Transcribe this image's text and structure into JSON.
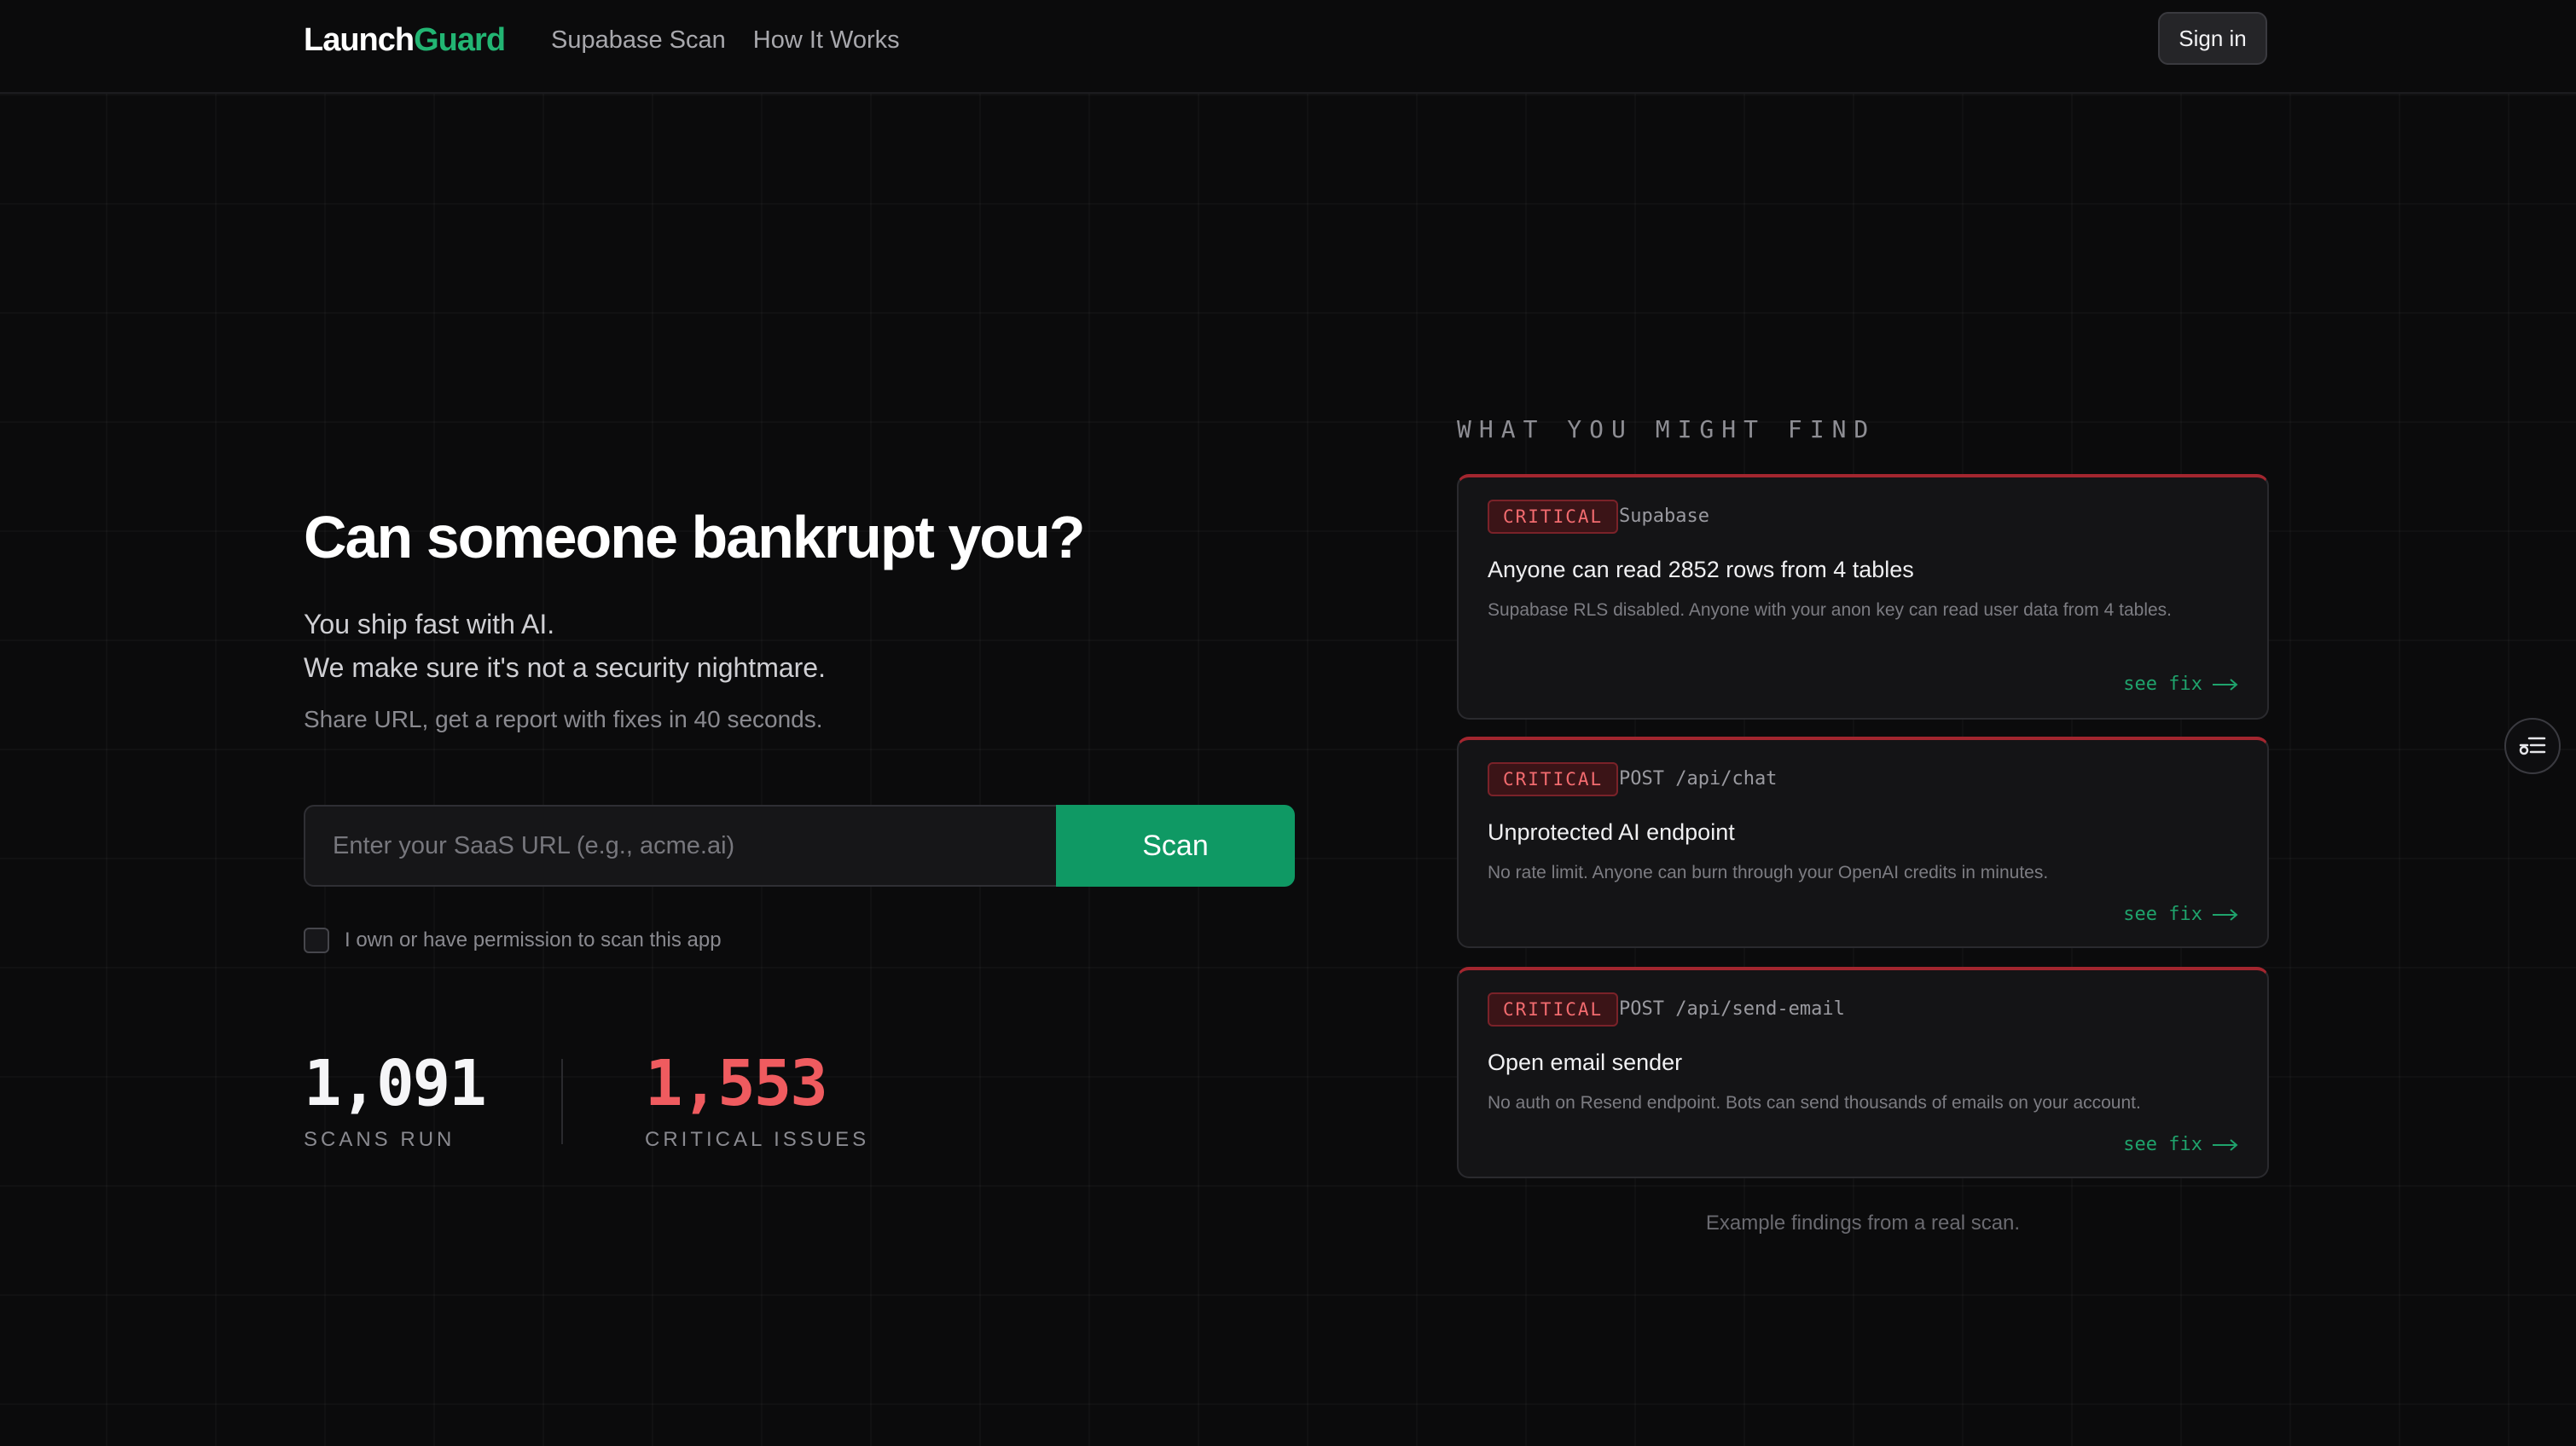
{
  "nav": {
    "logo_part1": "Launch",
    "logo_part2": "Guard",
    "links": [
      "Supabase Scan",
      "How It Works"
    ],
    "signin_label": "Sign in"
  },
  "hero": {
    "title": "Can someone bankrupt you?",
    "subtitle_line1": "You ship fast with AI.",
    "subtitle_line2": "We make sure it's not a security nightmare.",
    "tagline": "Share URL, get a report with fixes in 40 seconds.",
    "input_placeholder": "Enter your SaaS URL (e.g., acme.ai)",
    "input_value": "",
    "scan_label": "Scan",
    "permission_label": "I own or have permission to scan this app",
    "permission_checked": false
  },
  "stats": [
    {
      "value": "1,091",
      "label": "SCANS RUN",
      "color": "#f5f5f7"
    },
    {
      "value": "1,553",
      "label": "CRITICAL ISSUES",
      "color": "#ef5b5f"
    }
  ],
  "findings": {
    "title": "WHAT YOU MIGHT FIND",
    "cards": [
      {
        "severity": "CRITICAL",
        "tag": "Supabase",
        "title": "Anyone can read 2852 rows from 4 tables",
        "description": "Supabase RLS disabled. Anyone with your anon key can read user data from 4 tables.",
        "link": "see fix"
      },
      {
        "severity": "CRITICAL",
        "tag": "POST /api/chat",
        "title": "Unprotected AI endpoint",
        "description": "No rate limit. Anyone can burn through your OpenAI credits in minutes.",
        "link": "see fix"
      },
      {
        "severity": "CRITICAL",
        "tag": "POST /api/send-email",
        "title": "Open email sender",
        "description": "No auth on Resend endpoint. Bots can send thousands of emails on your account.",
        "link": "see fix"
      }
    ],
    "caption": "Example findings from a real scan."
  },
  "colors": {
    "accent_green": "#22b573",
    "scan_button": "#0f9964",
    "critical_red": "#ef5b5f",
    "background": "#0b0b0c"
  },
  "icons": {
    "floating_button": "settings-list-icon",
    "see_fix": "arrow-right-icon"
  }
}
